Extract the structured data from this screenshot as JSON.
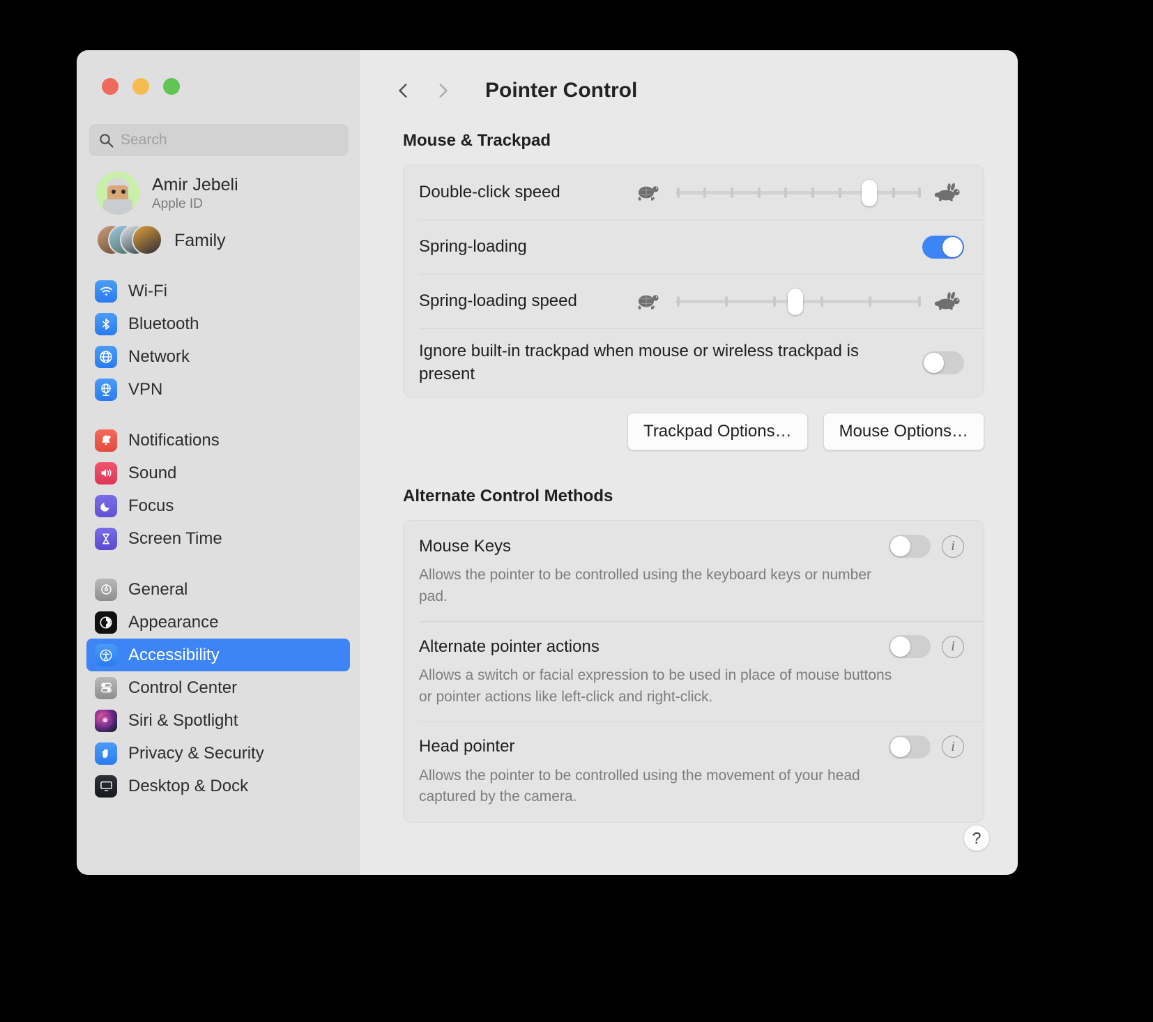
{
  "window": {
    "traffic_lights": [
      "close",
      "minimize",
      "zoom"
    ],
    "accent_color": "#3d85f7"
  },
  "sidebar": {
    "search": {
      "placeholder": "Search",
      "value": "",
      "icon": "search-icon"
    },
    "account": {
      "name": "Amir Jebeli",
      "subtitle": "Apple ID"
    },
    "family": {
      "label": "Family"
    },
    "groups": [
      {
        "items": [
          {
            "label": "Wi-Fi",
            "icon": "wifi-icon"
          },
          {
            "label": "Bluetooth",
            "icon": "bluetooth-icon"
          },
          {
            "label": "Network",
            "icon": "globe-icon"
          },
          {
            "label": "VPN",
            "icon": "vpn-globe-icon"
          }
        ]
      },
      {
        "items": [
          {
            "label": "Notifications",
            "icon": "bell-icon"
          },
          {
            "label": "Sound",
            "icon": "speaker-icon"
          },
          {
            "label": "Focus",
            "icon": "moon-icon"
          },
          {
            "label": "Screen Time",
            "icon": "hourglass-icon"
          }
        ]
      },
      {
        "items": [
          {
            "label": "General",
            "icon": "gear-icon"
          },
          {
            "label": "Appearance",
            "icon": "contrast-icon"
          },
          {
            "label": "Accessibility",
            "icon": "accessibility-icon",
            "selected": true
          },
          {
            "label": "Control Center",
            "icon": "switches-icon"
          },
          {
            "label": "Siri & Spotlight",
            "icon": "siri-icon"
          },
          {
            "label": "Privacy & Security",
            "icon": "hand-icon"
          },
          {
            "label": "Desktop & Dock",
            "icon": "desktop-icon"
          }
        ]
      }
    ]
  },
  "main": {
    "back_label": "Back",
    "forward_label": "Forward",
    "title": "Pointer Control",
    "sections": [
      {
        "heading": "Mouse & Trackpad",
        "rows": [
          {
            "label": "Double-click speed",
            "control": "slider",
            "min_icon": "turtle-icon",
            "max_icon": "rabbit-icon",
            "ticks": 10,
            "value": 8
          },
          {
            "label": "Spring-loading",
            "control": "toggle",
            "value": "on"
          },
          {
            "label": "Spring-loading speed",
            "control": "slider",
            "min_icon": "turtle-icon",
            "max_icon": "rabbit-icon",
            "ticks": 6,
            "value": 2.4
          },
          {
            "label": "Ignore built-in trackpad when mouse or wireless trackpad is present",
            "control": "toggle",
            "value": "off"
          }
        ],
        "buttons": [
          {
            "label": "Trackpad Options…"
          },
          {
            "label": "Mouse Options…"
          }
        ]
      },
      {
        "heading": "Alternate Control Methods",
        "features": [
          {
            "title": "Mouse Keys",
            "description": "Allows the pointer to be controlled using the keyboard keys or number pad.",
            "toggle": "off",
            "info": "info-icon"
          },
          {
            "title": "Alternate pointer actions",
            "description": "Allows a switch or facial expression to be used in place of mouse buttons or pointer actions like left-click and right-click.",
            "toggle": "off",
            "info": "info-icon"
          },
          {
            "title": "Head pointer",
            "description": "Allows the pointer to be controlled using the movement of your head captured by the camera.",
            "toggle": "off",
            "info": "info-icon"
          }
        ]
      }
    ],
    "help_label": "?"
  }
}
